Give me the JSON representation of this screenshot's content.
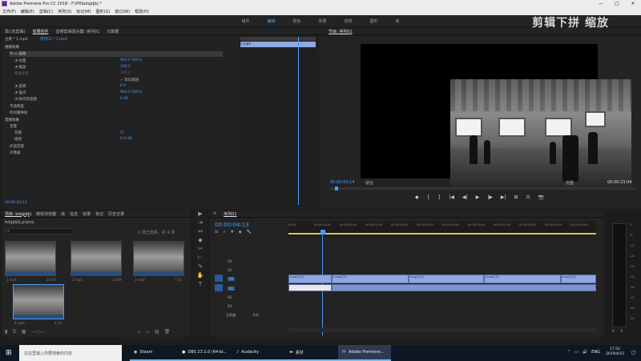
{
  "window": {
    "title": "Adobe Premiere Pro CC 2018 - F:\\PR\\bdqjdjkj *",
    "controls": [
      "—",
      "□",
      "✕"
    ]
  },
  "menu": [
    "文件(F)",
    "编辑(E)",
    "剪辑(C)",
    "序列(S)",
    "标记(M)",
    "图形(G)",
    "窗口(W)",
    "帮助(H)"
  ],
  "workspaces": [
    {
      "label": "组件"
    },
    {
      "label": "编辑"
    },
    {
      "label": "颜色"
    },
    {
      "label": "效果"
    },
    {
      "label": "音频"
    },
    {
      "label": "图形"
    },
    {
      "label": "库"
    }
  ],
  "overlay_text": "剪辑下拼 缩放",
  "effect_controls": {
    "tabs": [
      "源:(无剪辑)",
      "效果控件",
      "音频剪辑混合器: 序列01",
      "元数据"
    ],
    "source": "主要 * 1.mp4",
    "clip": "序列01 * 1.mp4",
    "section_video": "视频效果",
    "motion": "运动",
    "rows": [
      {
        "label": "位置",
        "value": "960.0    540.0"
      },
      {
        "label": "缩放",
        "value": "100.0"
      },
      {
        "label": "缩放宽度",
        "value": "100.0"
      },
      {
        "label": "等比缩放",
        "value": "✓ 等比缩放"
      },
      {
        "label": "旋转",
        "value": "0.0"
      },
      {
        "label": "锚点",
        "value": "960.0    540.0"
      },
      {
        "label": "防闪烁滤镜",
        "value": "0.00"
      },
      {
        "label": "不透明度",
        "value": ""
      },
      {
        "label": "时间重映射",
        "value": ""
      }
    ],
    "section_audio": "音频效果",
    "audio_rows": [
      {
        "label": "音量",
        "value": ""
      },
      {
        "label": "旁路",
        "value": "□"
      },
      {
        "label": "级别",
        "value": "0.0 dB"
      },
      {
        "label": "声道音量",
        "value": ""
      },
      {
        "label": "声像器",
        "value": ""
      }
    ],
    "mini_clip": "1.mp4",
    "timecode": "00:00:04:13"
  },
  "program": {
    "tab": "节目: 序列01",
    "timecode": "00:00:04:14",
    "fit": "适合",
    "full": "完整",
    "duration": "00:00:23:04",
    "transport": [
      "◆",
      "{",
      "}",
      "|◀",
      "◀|",
      "▶",
      "|▶",
      "▶|",
      "⊞",
      "⊡",
      "📷"
    ]
  },
  "project": {
    "tabs": [
      "项目: bdqjdjkj",
      "媒体浏览器",
      "库",
      "信息",
      "效果",
      "标记",
      "历史记录"
    ],
    "path": "bdqjdjkj.prproj",
    "count": "1 项已选择，共 4 项",
    "items": [
      {
        "name": "1.mp4",
        "dur": "23:04"
      },
      {
        "name": "2.mp4",
        "dur": "12:09"
      },
      {
        "name": "3.mp4",
        "dur": "7:25"
      },
      {
        "name": "4.mp4",
        "dur": "4:15"
      }
    ]
  },
  "tools": [
    "▶",
    "⇥",
    "↔",
    "◆",
    "✂",
    "⊢",
    "✎",
    "✋",
    "T"
  ],
  "timeline": {
    "tab": "序列01",
    "timecode": "00:00:04:13",
    "ruler": [
      "00:00",
      "00:00:04:00",
      "00:00:08:00",
      "00:00:12:00",
      "00:00:16:00",
      "00:00:20:00",
      "00:00:24:00",
      "00:00:28:00",
      "00:00:32:00",
      "00:00:36:00",
      "00:00:40:00",
      "00:00:44:00"
    ],
    "tracks": [
      "V3",
      "V2",
      "V1",
      "A1",
      "A2",
      "A3"
    ],
    "master": "主声道",
    "master_val": "0.0",
    "clips": [
      {
        "name": "1.mp4 [V]"
      },
      {
        "name": "2.mp4 [V]"
      },
      {
        "name": "3.mp4 [V]"
      },
      {
        "name": "4.mp4 [V]"
      },
      {
        "name": "4.mp4 [V]"
      }
    ]
  },
  "meter": {
    "labels": [
      "0",
      "-6",
      "-12",
      "-18",
      "-24",
      "-30",
      "-36",
      "-42",
      "-48",
      "-54"
    ],
    "bottom": [
      "S",
      "S"
    ]
  },
  "taskbar": {
    "search": "在这里输入你要搜索的内容",
    "tasks": [
      {
        "label": "Steam"
      },
      {
        "label": "OBS 23.1.0 (64-bi..."
      },
      {
        "label": "Audacity"
      },
      {
        "label": "素材"
      },
      {
        "label": "Adobe Premiere..."
      }
    ],
    "lang": "ENG",
    "time": "17:52",
    "date": "2019/4/15"
  }
}
